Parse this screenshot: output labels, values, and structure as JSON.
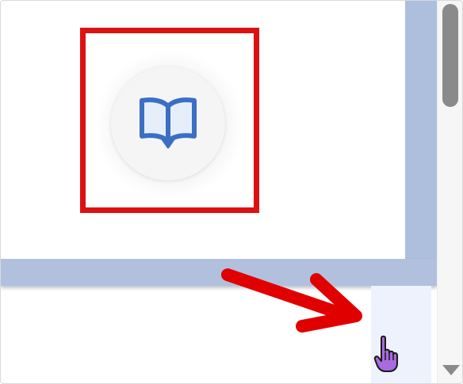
{
  "colors": {
    "highlight_box": "#dd1111",
    "annotation_arrow": "#e00000",
    "panel_shadow": "#b0c0dd",
    "icon_stroke": "#3a6fc4",
    "icon_fill": "#e6eef9",
    "cursor_fill": "#a96ae0"
  },
  "icons": {
    "center_icon": "open-book-icon",
    "cursor": "hand-pointer-cursor",
    "annotation": "red-arrow"
  }
}
